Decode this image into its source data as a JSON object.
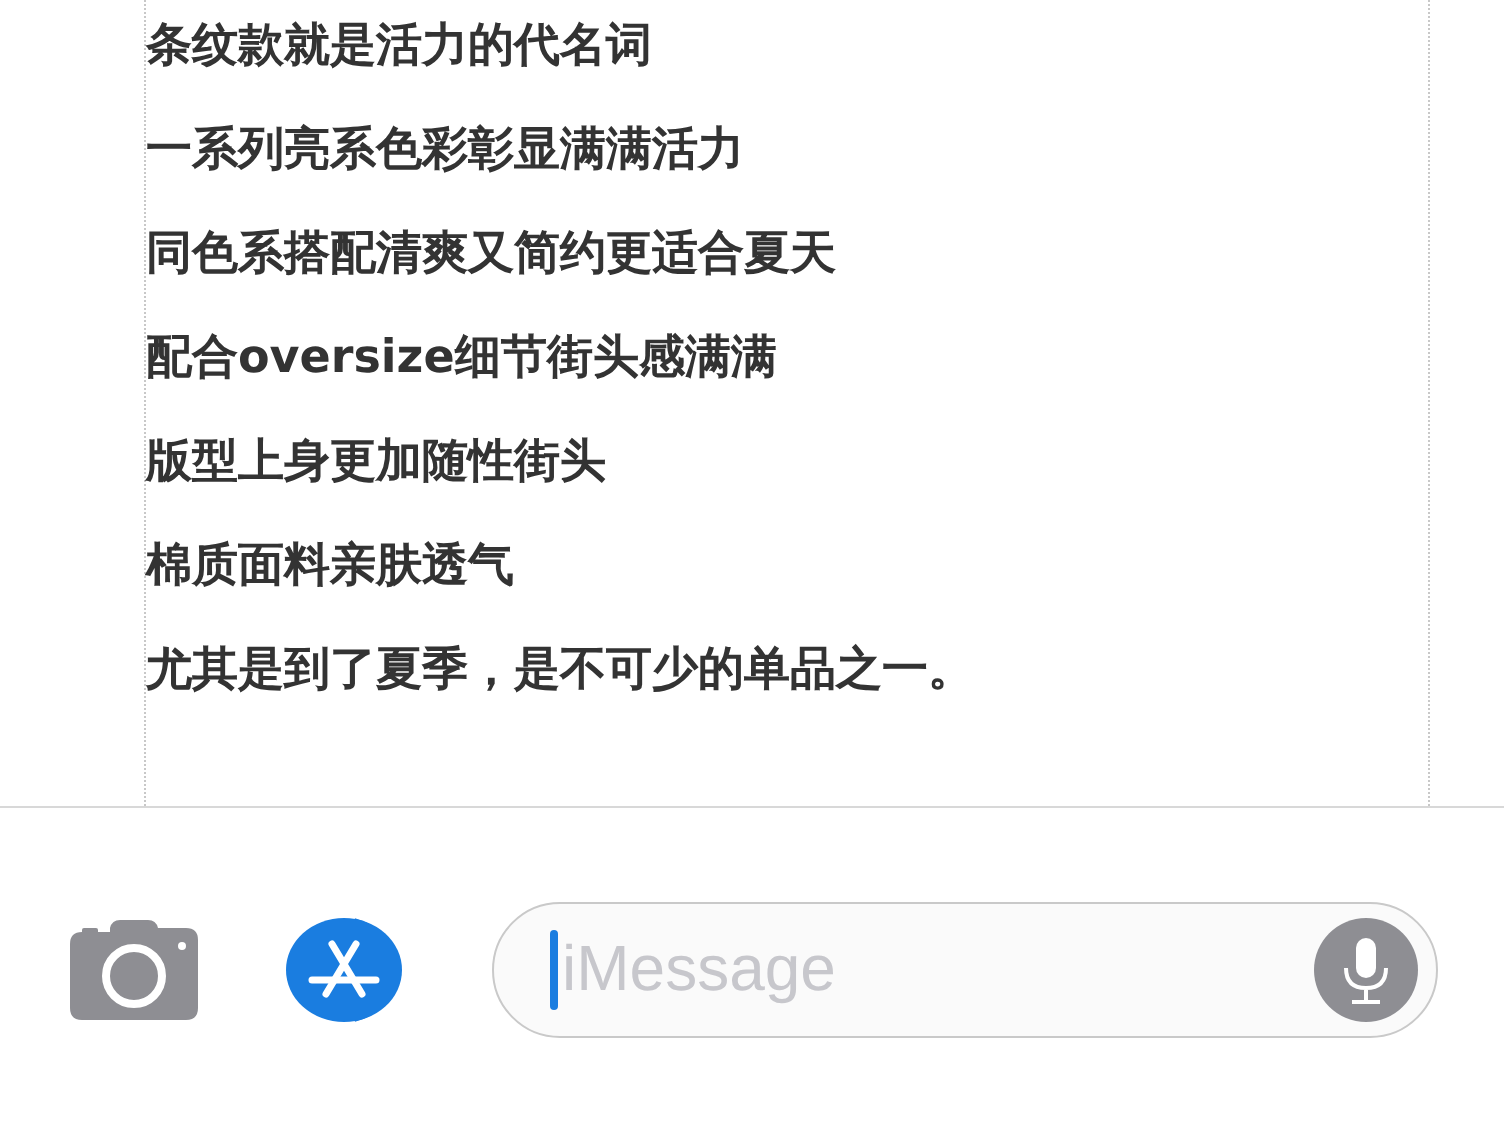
{
  "document": {
    "lines": [
      "条纹款就是活力的代名词",
      "一系列亮系色彩彰显满满活力",
      "同色系搭配清爽又简约更适合夏天",
      "配合oversize细节街头感满满",
      "版型上身更加随性街头",
      "棉质面料亲肤透气",
      "尤其是到了夏季，是不可少的单品之一。"
    ]
  },
  "message_bar": {
    "placeholder": "iMessage"
  }
}
